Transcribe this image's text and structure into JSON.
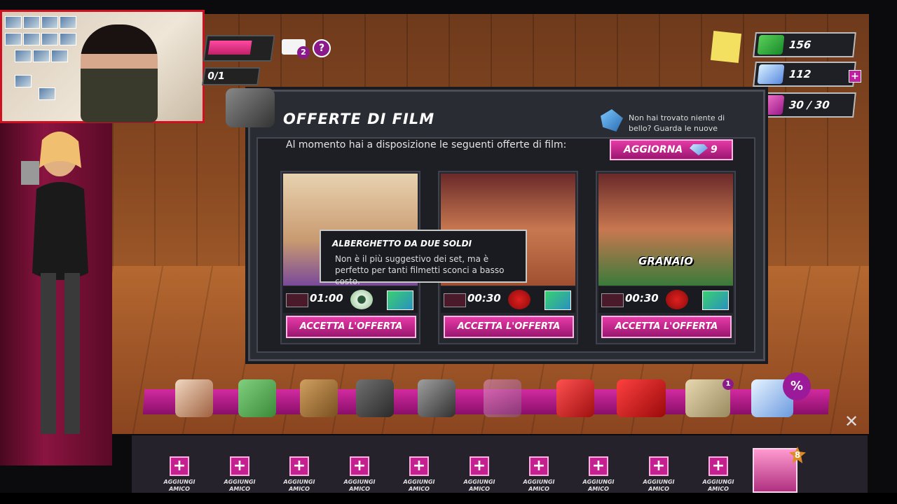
{
  "webcam": {
    "label": "streamer webcam overlay"
  },
  "hud": {
    "progress_fraction": 0.72,
    "counter": "0/1",
    "mail_badge": "2",
    "help_label": "?"
  },
  "resources": {
    "cash": "156",
    "diamonds": "112",
    "energy": "30 / 30",
    "add_label": "+"
  },
  "dialog": {
    "title": "OFFERTE DI FILM",
    "subtitle": "Al momento hai a disposizione le seguenti offerte di film:",
    "refresh_text": "Non hai trovato niente di bello? Guarda le nuove",
    "refresh_button": "AGGIORNA",
    "refresh_cost": "9",
    "cards": [
      {
        "name": "ALBE",
        "time": "01:00",
        "reward_icon": "eye-icon",
        "button": "ACCETTA L'OFFERTA"
      },
      {
        "name": "",
        "time": "00:30",
        "reward_icon": "heart-icon",
        "button": "ACCETTA L'OFFERTA"
      },
      {
        "name": "GRANAIO",
        "time": "00:30",
        "reward_icon": "heart-icon",
        "button": "ACCETTA L'OFFERTA"
      }
    ]
  },
  "tooltip": {
    "title": "ALBERGHETTO DA DUE SOLDI",
    "text": "Non è il più suggestivo dei set, ma è perfetto per tanti filmetti sconci a basso costo."
  },
  "toolbar": {
    "items": [
      "profile-book-icon",
      "map-icon",
      "bag-icon",
      "glove-icon",
      "camera-icon",
      "laptop-icon",
      "soda-can-icon",
      "red-bed-icon",
      "podium-icon",
      "diamonds-shop-icon"
    ],
    "podium_badge": "1",
    "sale_badge": "%",
    "settings_icon": "wrench-icon"
  },
  "friends": {
    "slots": [
      "AGGIUNGI AMICO",
      "AGGIUNGI AMICO",
      "AGGIUNGI AMICO",
      "AGGIUNGI AMICO",
      "AGGIUNGI AMICO",
      "AGGIUNGI AMICO",
      "AGGIUNGI AMICO",
      "AGGIUNGI AMICO",
      "AGGIUNGI AMICO",
      "AGGIUNGI AMICO"
    ],
    "plus": "+",
    "model_badge": "8"
  },
  "colors": {
    "accent": "#d22aa0",
    "panel": "#2a2c33",
    "button": "#c0208a"
  }
}
